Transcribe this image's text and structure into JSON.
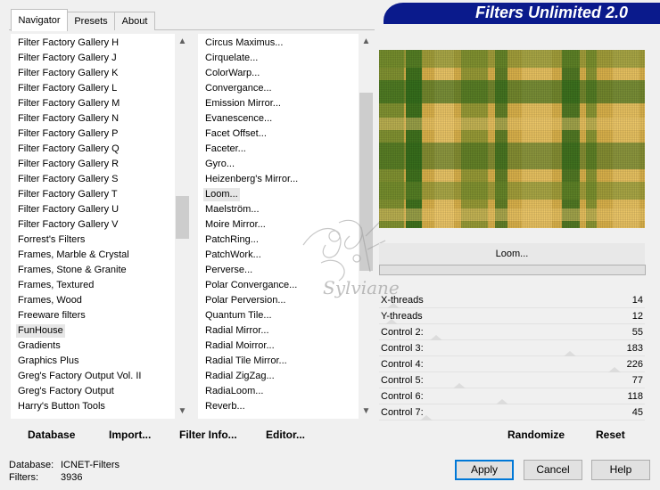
{
  "banner": {
    "title": "Filters Unlimited 2.0"
  },
  "tabs": [
    {
      "label": "Navigator",
      "active": true
    },
    {
      "label": "Presets",
      "active": false
    },
    {
      "label": "About",
      "active": false
    }
  ],
  "categories": {
    "items": [
      "Filter Factory Gallery H",
      "Filter Factory Gallery J",
      "Filter Factory Gallery K",
      "Filter Factory Gallery L",
      "Filter Factory Gallery M",
      "Filter Factory Gallery N",
      "Filter Factory Gallery P",
      "Filter Factory Gallery Q",
      "Filter Factory Gallery R",
      "Filter Factory Gallery S",
      "Filter Factory Gallery T",
      "Filter Factory Gallery U",
      "Filter Factory Gallery V",
      "Forrest's Filters",
      "Frames, Marble & Crystal",
      "Frames, Stone & Granite",
      "Frames, Textured",
      "Frames, Wood",
      "Freeware filters",
      "FunHouse",
      "Gradients",
      "Graphics Plus",
      "Greg's Factory Output Vol. II",
      "Greg's Factory Output",
      "Harry's Button Tools"
    ],
    "selected": "FunHouse"
  },
  "filters": {
    "items": [
      "Circus Maximus...",
      "Cirquelate...",
      "ColorWarp...",
      "Convergance...",
      "Emission Mirror...",
      "Evanescence...",
      "Facet Offset...",
      "Faceter...",
      "Gyro...",
      "Heizenberg's Mirror...",
      "Loom...",
      "Maelström...",
      "Moire Mirror...",
      "PatchRing...",
      "PatchWork...",
      "Perverse...",
      "Polar Convergance...",
      "Polar Perversion...",
      "Quantum Tile...",
      "Radial Mirror...",
      "Radial Moirror...",
      "Radial Tile Mirror...",
      "Radial ZigZag...",
      "RadiaLoom...",
      "Reverb..."
    ],
    "selected": "Loom..."
  },
  "nav_buttons": {
    "database": "Database",
    "import": "Import...",
    "filter_info": "Filter Info...",
    "editor": "Editor..."
  },
  "preview": {
    "filter_name": "Loom...",
    "colors": {
      "dark_green": "#2f6a1a",
      "mid_green": "#6a8a2a",
      "gold": "#d8b04a",
      "light_gold": "#f0cc70"
    }
  },
  "controls": [
    {
      "label": "X-threads",
      "value": "14",
      "level": 14
    },
    {
      "label": "Y-threads",
      "value": "12",
      "level": 12
    },
    {
      "label": "Control 2:",
      "value": "55",
      "level": 55
    },
    {
      "label": "Control 3:",
      "value": "183",
      "level": 183
    },
    {
      "label": "Control 4:",
      "value": "226",
      "level": 226
    },
    {
      "label": "Control 5:",
      "value": "77",
      "level": 77
    },
    {
      "label": "Control 6:",
      "value": "118",
      "level": 118
    },
    {
      "label": "Control 7:",
      "value": "45",
      "level": 45
    }
  ],
  "right_buttons": {
    "randomize": "Randomize",
    "reset": "Reset"
  },
  "status": {
    "database_label": "Database:",
    "database_value": "ICNET-Filters",
    "filters_label": "Filters:",
    "filters_value": "3936"
  },
  "dialog_buttons": {
    "apply": "Apply",
    "cancel": "Cancel",
    "help": "Help"
  },
  "watermark": {
    "text": "Sylviane"
  }
}
